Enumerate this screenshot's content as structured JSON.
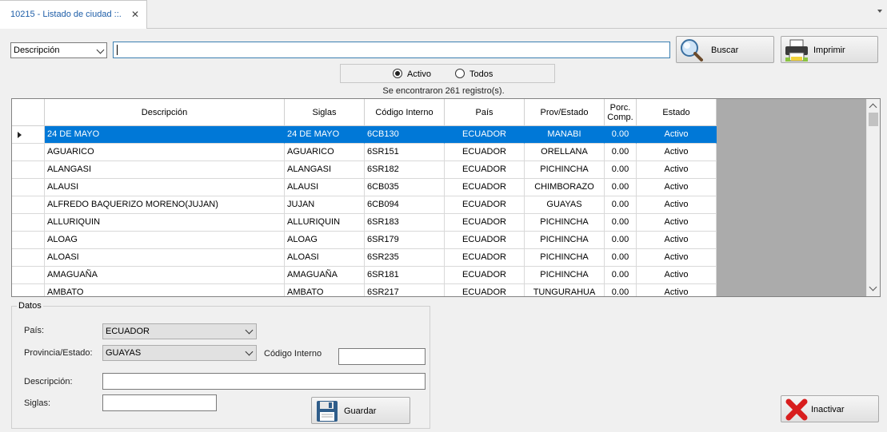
{
  "tab": {
    "title": "10215 - Listado de ciudad ::.",
    "close": "✕"
  },
  "search": {
    "field_option": "Descripción",
    "query": ""
  },
  "buttons": {
    "buscar": "Buscar",
    "imprimir": "Imprimir",
    "guardar": "Guardar",
    "inactivar": "Inactivar"
  },
  "filter": {
    "activo_label": "Activo",
    "todos_label": "Todos",
    "selected": "Activo"
  },
  "records_text": "Se encontraron 261 registro(s).",
  "grid": {
    "columns": [
      "Descripción",
      "Siglas",
      "Código Interno",
      "País",
      "Prov/Estado",
      "Porc. Comp.",
      "Estado"
    ],
    "rows": [
      [
        "24 DE MAYO",
        "24 DE MAYO",
        "6CB130",
        "ECUADOR",
        "MANABI",
        "0.00",
        "Activo"
      ],
      [
        "AGUARICO",
        "AGUARICO",
        "6SR151",
        "ECUADOR",
        "ORELLANA",
        "0.00",
        "Activo"
      ],
      [
        "ALANGASI",
        "ALANGASI",
        "6SR182",
        "ECUADOR",
        "PICHINCHA",
        "0.00",
        "Activo"
      ],
      [
        "ALAUSI",
        "ALAUSI",
        "6CB035",
        "ECUADOR",
        "CHIMBORAZO",
        "0.00",
        "Activo"
      ],
      [
        "ALFREDO BAQUERIZO MORENO(JUJAN)",
        "JUJAN",
        "6CB094",
        "ECUADOR",
        "GUAYAS",
        "0.00",
        "Activo"
      ],
      [
        "ALLURIQUIN",
        "ALLURIQUIN",
        "6SR183",
        "ECUADOR",
        "PICHINCHA",
        "0.00",
        "Activo"
      ],
      [
        "ALOAG",
        "ALOAG",
        "6SR179",
        "ECUADOR",
        "PICHINCHA",
        "0.00",
        "Activo"
      ],
      [
        "ALOASI",
        "ALOASI",
        "6SR235",
        "ECUADOR",
        "PICHINCHA",
        "0.00",
        "Activo"
      ],
      [
        "AMAGUAÑA",
        "AMAGUAÑA",
        "6SR181",
        "ECUADOR",
        "PICHINCHA",
        "0.00",
        "Activo"
      ],
      [
        "AMBATO",
        "AMBATO",
        "6SR217",
        "ECUADOR",
        "TUNGURAHUA",
        "0.00",
        "Activo"
      ]
    ]
  },
  "datos": {
    "title": "Datos",
    "pais_label": "País:",
    "pais_value": "ECUADOR",
    "provincia_label": "Provincia/Estado:",
    "provincia_value": "GUAYAS",
    "codigo_label": "Código Interno",
    "codigo_value": "",
    "descripcion_label": "Descripción:",
    "descripcion_value": "",
    "siglas_label": "Siglas:",
    "siglas_value": ""
  },
  "colors": {
    "selection": "#0078d7",
    "tab_text": "#1e5ea8",
    "background": "#f0f0f0"
  },
  "icons": {
    "buscar": "magnifier-icon",
    "imprimir": "printer-icon",
    "guardar": "floppy-disk-icon",
    "inactivar": "red-x-icon"
  }
}
